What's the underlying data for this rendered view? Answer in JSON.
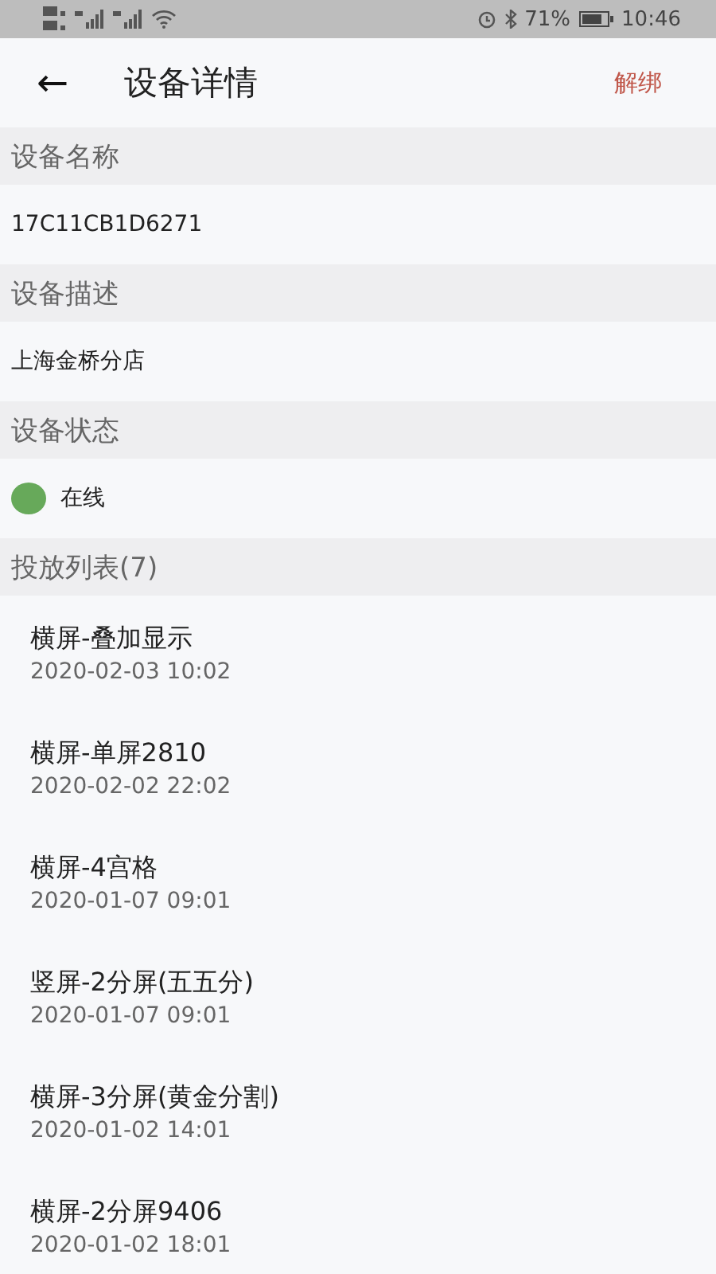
{
  "status_bar": {
    "battery_percent": "71%",
    "time": "10:46"
  },
  "app_bar": {
    "back": "←",
    "title": "设备详情",
    "action": "解绑"
  },
  "sections": [
    {
      "header": "设备名称",
      "kind": "text",
      "value": "17C11CB1D6271"
    },
    {
      "header": "设备描述",
      "kind": "text",
      "value": "上海金桥分店"
    },
    {
      "header": "设备状态",
      "kind": "status",
      "value": "在线",
      "color": "#67a95a"
    },
    {
      "header": "投放列表(7)",
      "kind": "list",
      "items": [
        {
          "title": "横屏-叠加显示",
          "date": "2020-02-03 10:02"
        },
        {
          "title": "横屏-单屏2810",
          "date": "2020-02-02 22:02"
        },
        {
          "title": "横屏-4宫格",
          "date": "2020-01-07 09:01"
        },
        {
          "title": "竖屏-2分屏(五五分)",
          "date": "2020-01-07 09:01"
        },
        {
          "title": "横屏-3分屏(黄金分割)",
          "date": "2020-01-02 14:01"
        },
        {
          "title": "横屏-2分屏9406",
          "date": "2020-01-02 18:01"
        }
      ]
    }
  ]
}
